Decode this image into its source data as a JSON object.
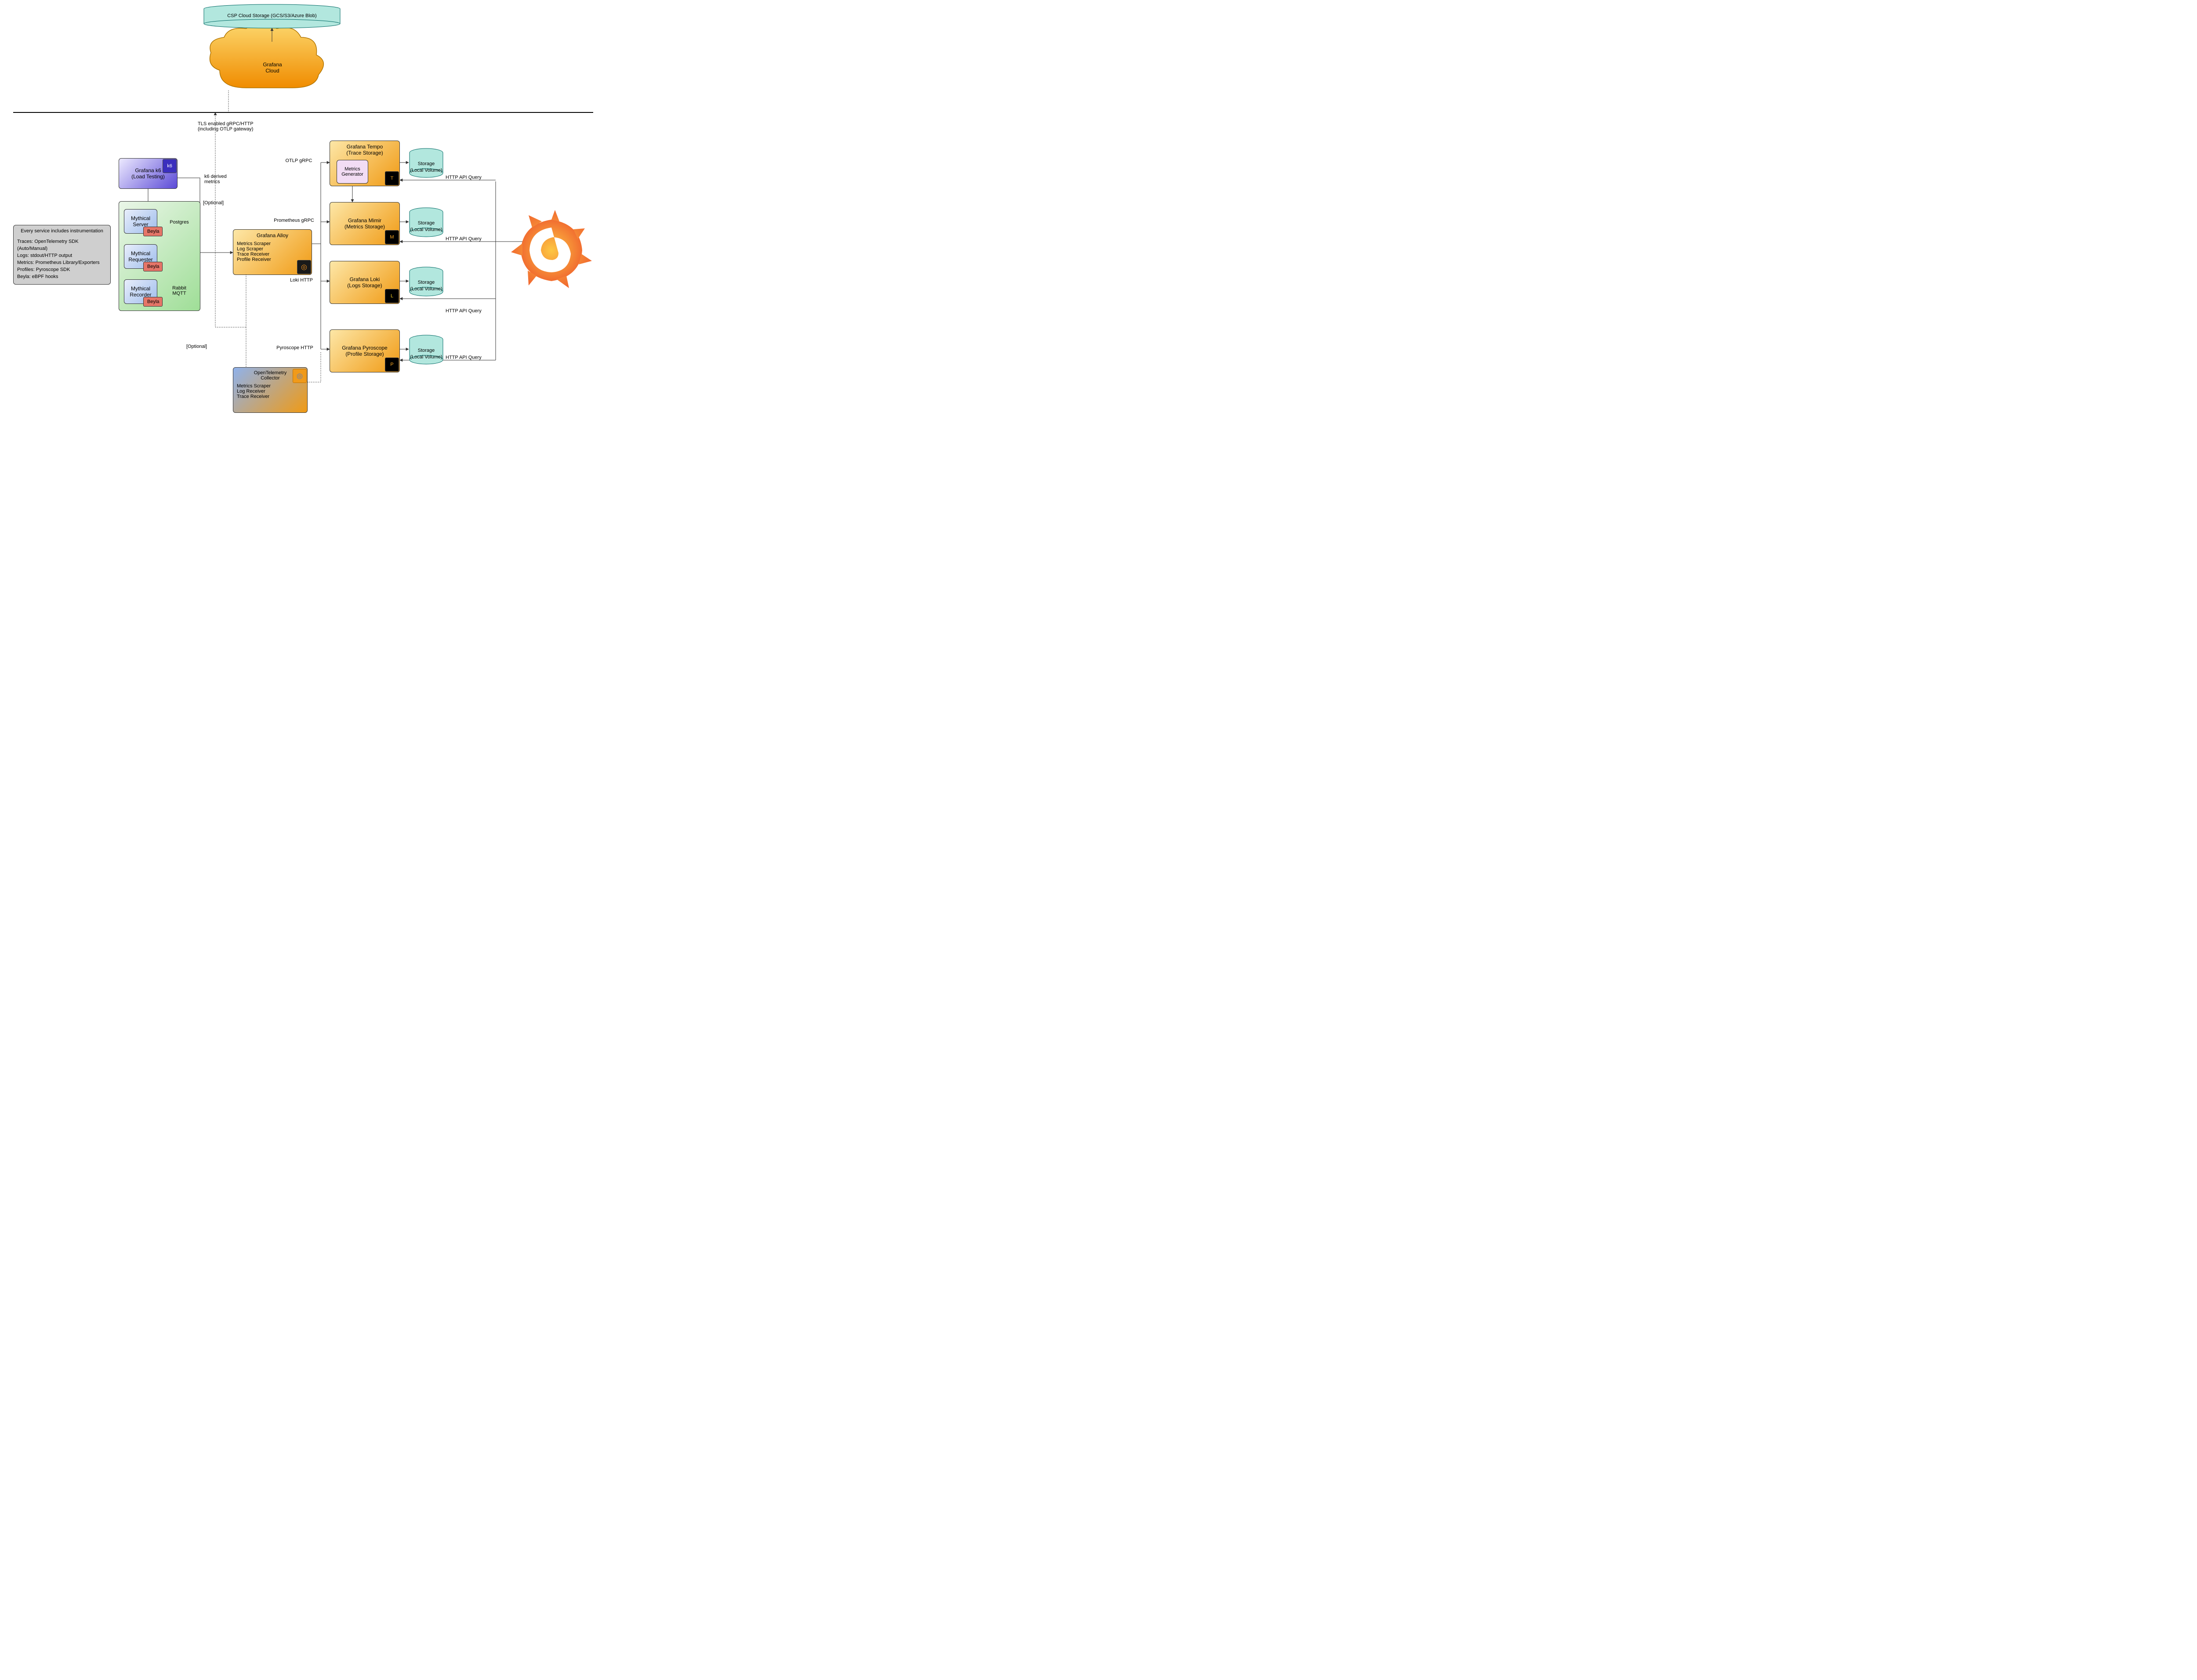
{
  "cloud_storage": "CSP Cloud Storage (GCS/S3/Azure Blob)",
  "grafana_cloud": {
    "l1": "Grafana",
    "l2": "Cloud"
  },
  "tls_note": {
    "l1": "TLS enabled gRPC/HTTP",
    "l2": "(including OTLP gateway)"
  },
  "k6_box": {
    "l1": "Grafana k6",
    "l2": "(Load Testing)"
  },
  "k6_metrics": {
    "l1": "k6 derived",
    "l2": "metrics"
  },
  "optional": "[Optional]",
  "instrumentation": {
    "header": "Every service includes instrumentation",
    "lines": [
      "Traces:  OpenTelemetry SDK (Auto/Manual)",
      "Logs:     stdout/HTTP output",
      "Metrics: Prometheus Library/Exporters",
      "Profiles: Pyroscope SDK",
      "Beyla:    eBPF hooks"
    ]
  },
  "mythical": {
    "server": {
      "l1": "Mythical",
      "l2": "Server"
    },
    "requester": {
      "l1": "Mythical",
      "l2": "Requester"
    },
    "recorder": {
      "l1": "Mythical",
      "l2": "Recorder"
    },
    "beyla": "Beyla",
    "postgres": "Postgres",
    "rabbit": {
      "l1": "Rabbit",
      "l2": "MQTT"
    }
  },
  "alloy": {
    "title": "Grafana Alloy",
    "lines": [
      "Metrics Scraper",
      "Log Scraper",
      "Trace Receiver",
      "Profile Receiver"
    ]
  },
  "otel": {
    "title": {
      "l1": "OpenTelemetry",
      "l2": "Collector"
    },
    "lines": [
      "Metrics Scraper",
      "Log Receiver",
      "Trace Receiver"
    ]
  },
  "edges": {
    "otlp_grpc": "OTLP gRPC",
    "prom_grpc": "Prometheus gRPC",
    "loki_http": "Loki HTTP",
    "pyro_http": "Pyroscope HTTP",
    "http_api": "HTTP API Query"
  },
  "tempo": {
    "l1": "Grafana Tempo",
    "l2": "(Trace Storage)",
    "metrics_gen": {
      "l1": "Metrics",
      "l2": "Generator"
    }
  },
  "mimir": {
    "l1": "Grafana Mimir",
    "l2": "(Metrics Storage)"
  },
  "loki": {
    "l1": "Grafana Loki",
    "l2": "(Logs Storage)"
  },
  "pyro": {
    "l1": "Grafana Pyroscope",
    "l2": "(Profile Storage)"
  },
  "storage": {
    "l1": "Storage",
    "l2": "(Local Volume)"
  },
  "icons": {
    "k6": "k6",
    "tempo": "T",
    "mimir": "M",
    "loki": "L",
    "pyro": "P",
    "alloy": "◎",
    "otel": "◎"
  }
}
